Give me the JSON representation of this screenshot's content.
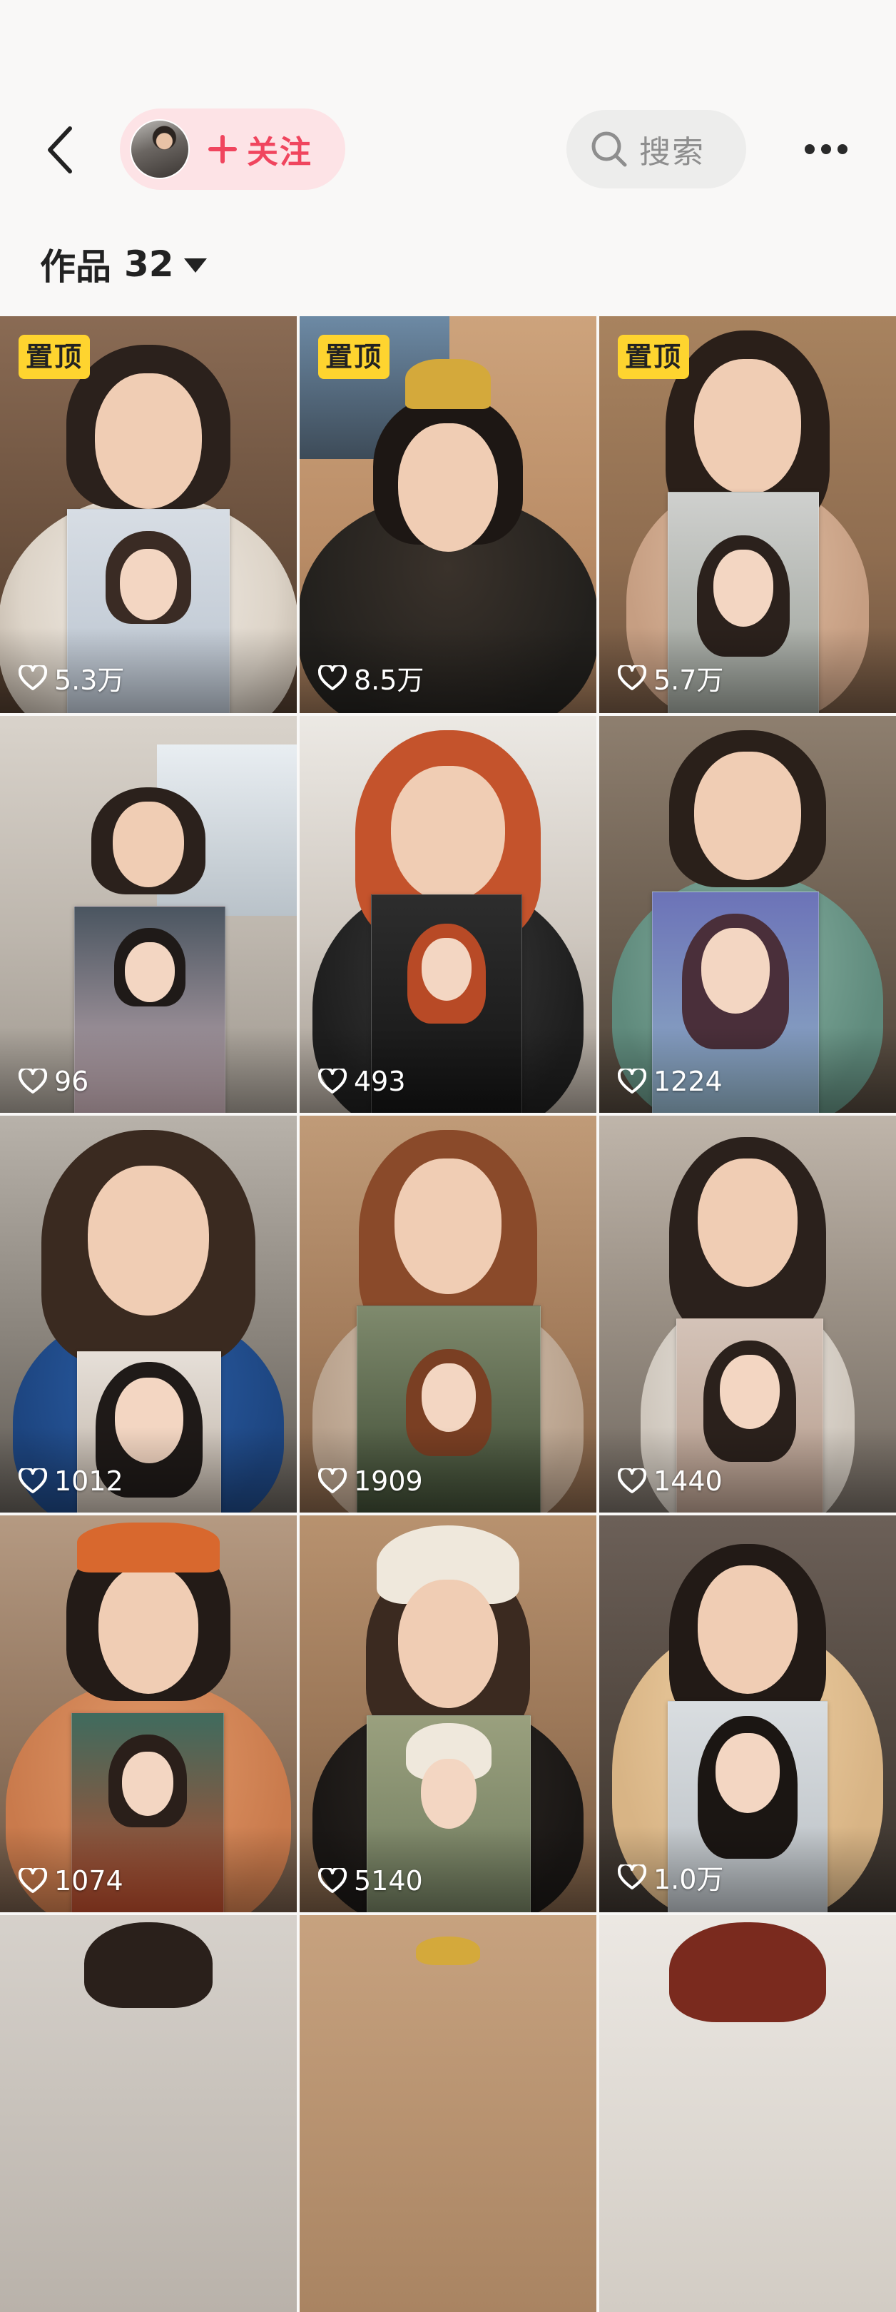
{
  "header": {
    "follow_label": "关注",
    "search_label": "搜索"
  },
  "works": {
    "label": "作品",
    "count": "32"
  },
  "icons": {
    "back": "chevron-left-icon",
    "plus": "plus-icon",
    "search": "search-icon",
    "more": "more-horizontal-icon",
    "caret": "caret-down-icon",
    "like": "heart-outline-icon"
  },
  "colors": {
    "accent": "#f0455e",
    "follow_bg": "#fde3e6",
    "pinned_badge": "#fed42f",
    "search_bg": "#ededec"
  },
  "videos": [
    {
      "pinned": "置顶",
      "likes": "5.3万"
    },
    {
      "pinned": "置顶",
      "likes": "8.5万"
    },
    {
      "pinned": "置顶",
      "likes": "5.7万"
    },
    {
      "likes": "96"
    },
    {
      "likes": "493"
    },
    {
      "likes": "1224"
    },
    {
      "likes": "1012"
    },
    {
      "likes": "1909"
    },
    {
      "likes": "1440"
    },
    {
      "likes": "1074"
    },
    {
      "likes": "5140"
    },
    {
      "likes": "1.0万"
    },
    {},
    {},
    {}
  ]
}
